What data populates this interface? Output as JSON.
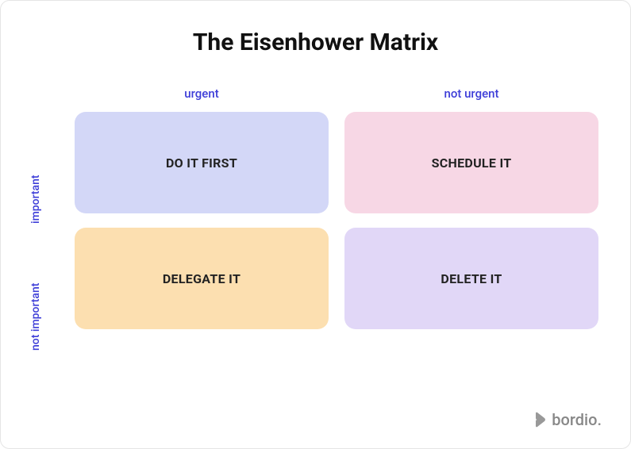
{
  "title": "The Eisenhower Matrix",
  "columns": {
    "urgent": "urgent",
    "not_urgent": "not urgent"
  },
  "rows": {
    "important": "important",
    "not_important": "not important"
  },
  "cells": {
    "do": "DO IT FIRST",
    "schedule": "SCHEDULE IT",
    "delegate": "DELEGATE IT",
    "delete": "DELETE IT"
  },
  "colors": {
    "do": "#d3d7f7",
    "schedule": "#f7d7e5",
    "delegate": "#fcdfb0",
    "delete": "#e1d7f7",
    "label": "#3d3dd8"
  },
  "brand": "bordio."
}
